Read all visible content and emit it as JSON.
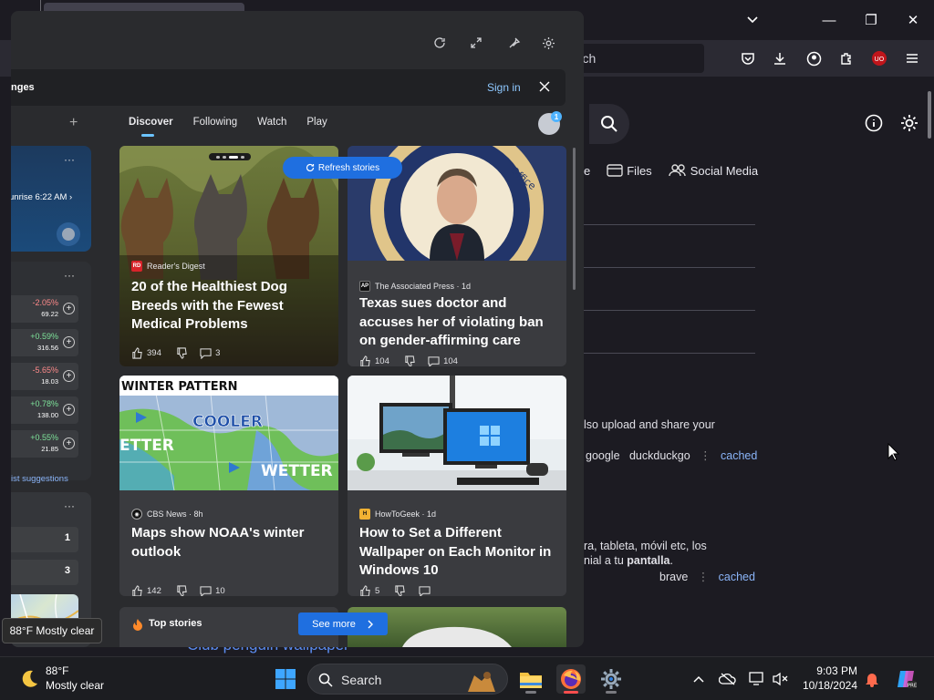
{
  "browser": {
    "url_placeholder": "arch",
    "caption": {
      "minimize": "—",
      "maximize": "❐",
      "close": "✕"
    }
  },
  "page": {
    "tabs": [
      {
        "label": "e"
      },
      {
        "label": "Files"
      },
      {
        "label": "Social Media"
      }
    ],
    "results": [
      {
        "snippet": "lso upload and share your"
      },
      {
        "engines": [
          "google",
          "duckduckgo"
        ],
        "cached": "cached"
      },
      {
        "snippet_line1": "ra, tableta, móvil etc, los",
        "snippet_line2_pre": "nial a tu ",
        "snippet_line2_bold": "pantalla",
        "snippet_line2_post": "."
      },
      {
        "engines": [
          "brave"
        ],
        "cached": "cached"
      }
    ],
    "club_link": "Club penguin wallpaper"
  },
  "widgets": {
    "signin_bar": {
      "title": "nges",
      "sign_in": "Sign in"
    },
    "feed_tabs": [
      "Discover",
      "Following",
      "Watch",
      "Play"
    ],
    "avatar_badge": "1",
    "refresh": "Refresh stories",
    "weather": {
      "sunrise": "unrise 6:22 AM",
      "more": "···"
    },
    "stocks": {
      "more": "···",
      "rows": [
        {
          "pct": "-2.05%",
          "val": "69.22",
          "dir": "neg"
        },
        {
          "pct": "+0.59%",
          "val": "316.56",
          "dir": "pos"
        },
        {
          "pct": "-5.65%",
          "val": "18.03",
          "dir": "neg"
        },
        {
          "pct": "+0.78%",
          "val": "138.00",
          "dir": "pos"
        },
        {
          "pct": "+0.55%",
          "val": "21.85",
          "dir": "pos"
        }
      ],
      "suggestions": "ist suggestions"
    },
    "sports": {
      "more": "···",
      "rows": [
        "1",
        "3"
      ]
    },
    "cards": [
      {
        "source": "Reader's Digest",
        "logo": "RD",
        "logo_color": "#d8232a",
        "title": "20 of the Healthiest Dog Breeds with the Fewest Medical Problems",
        "likes": "394",
        "comments": "3"
      },
      {
        "source": "The Associated Press · 1d",
        "logo": "AP",
        "logo_color": "#111111",
        "title": "Texas sues doctor and accuses her of violating ban on gender-affirming care",
        "likes": "104",
        "comments": "104"
      },
      {
        "source": "CBS News · 8h",
        "logo": "◉",
        "logo_color": "#111111",
        "title": "Maps show NOAA's winter outlook",
        "likes": "142",
        "comments": "10",
        "img_text": {
          "header": "WINTER PATTERN",
          "cooler": "COOLER",
          "wetter_left": "ETTER",
          "wetter_right": "WETTER"
        }
      },
      {
        "source": "HowToGeek · 1d",
        "logo": "H",
        "logo_color": "#f1b233",
        "title": "How to Set a Different Wallpaper on Each Monitor in Windows 10",
        "likes": "5",
        "comments": ""
      }
    ],
    "top_stories": "Top stories",
    "see_more": "See more"
  },
  "tooltip": "88°F Mostly clear",
  "taskbar": {
    "temp": "88°F",
    "condition": "Mostly clear",
    "search": "Search",
    "time": "9:03 PM",
    "date": "10/18/2024"
  }
}
